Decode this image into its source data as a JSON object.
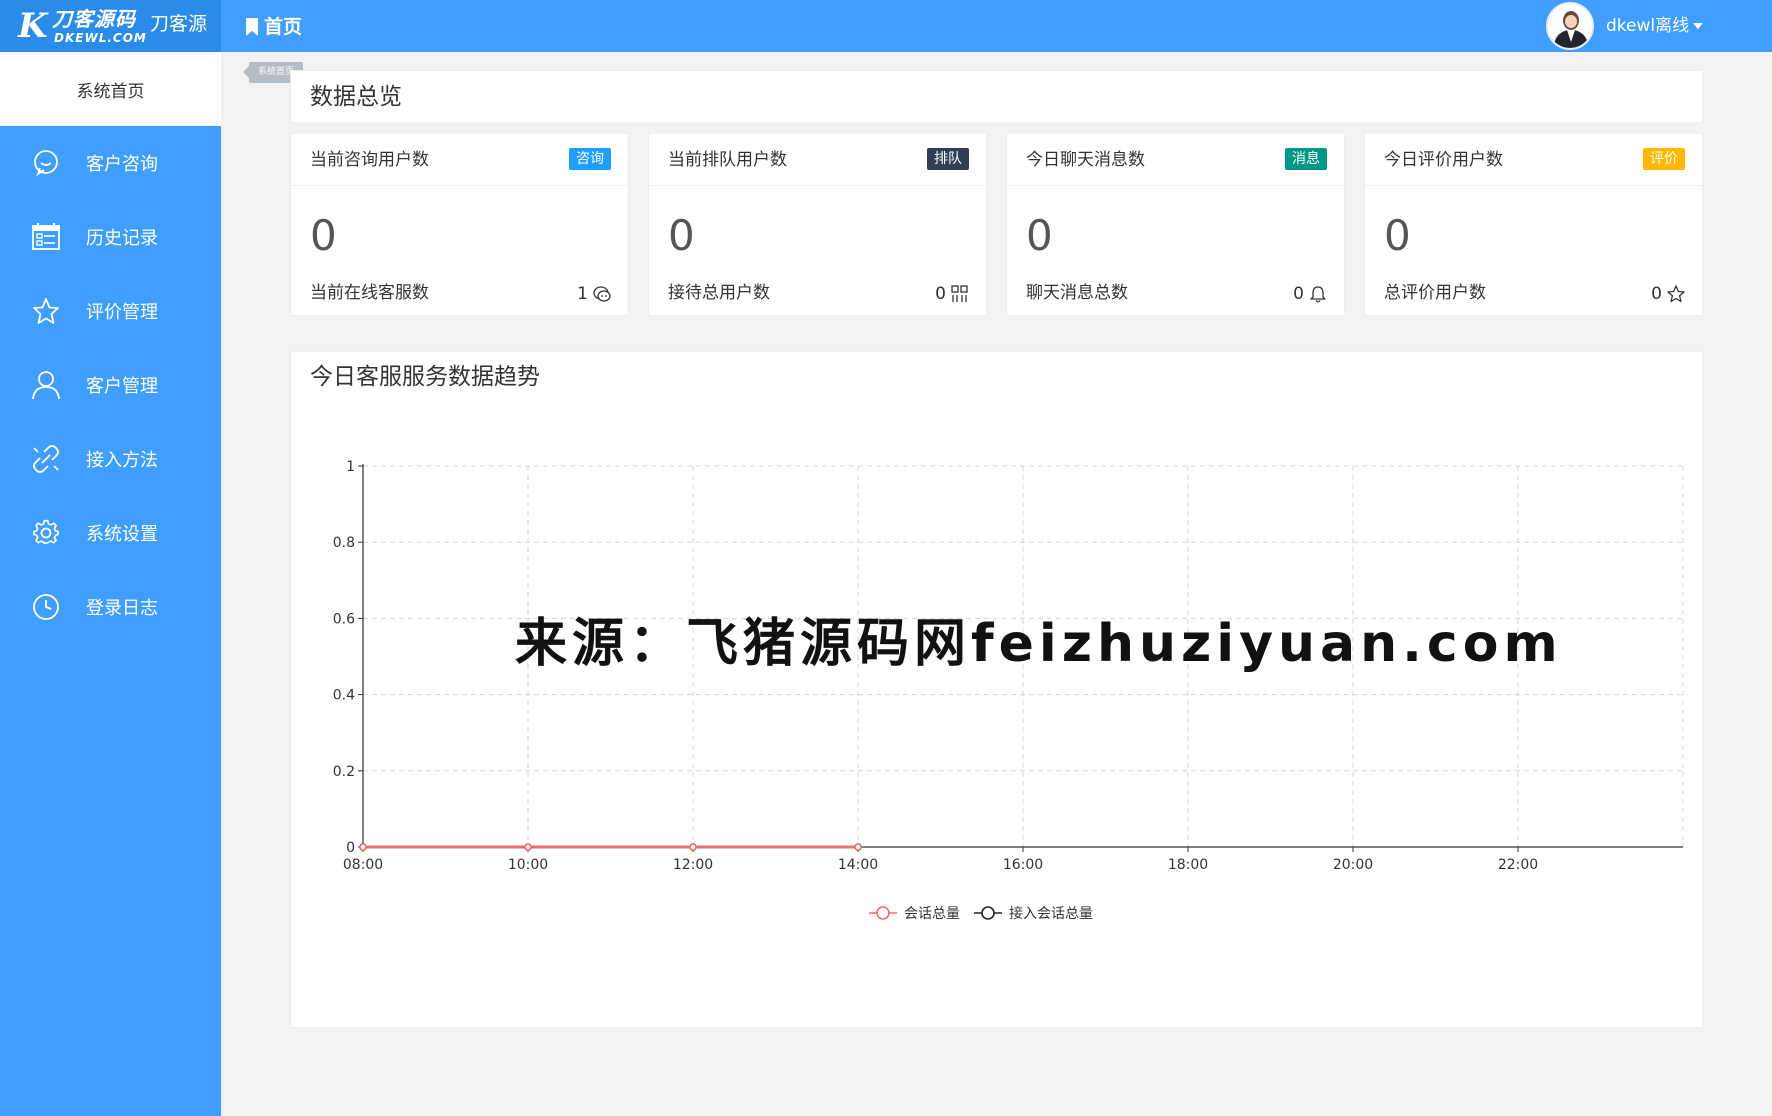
{
  "header": {
    "logo_text": "刀客源码",
    "logo_sub": "DKEWL.COM",
    "site_name": "刀客源",
    "breadcrumb": "首页",
    "user_status": "dkewl离线"
  },
  "sidebar": {
    "home_label": "系统首页",
    "items": [
      {
        "label": "客户咨询",
        "icon": "chat-bubble-icon"
      },
      {
        "label": "历史记录",
        "icon": "calendar-list-icon"
      },
      {
        "label": "评价管理",
        "icon": "star-icon"
      },
      {
        "label": "客户管理",
        "icon": "user-icon"
      },
      {
        "label": "接入方法",
        "icon": "link-icon"
      },
      {
        "label": "系统设置",
        "icon": "gear-icon"
      },
      {
        "label": "登录日志",
        "icon": "clock-icon"
      }
    ]
  },
  "tooltip": "系统首页",
  "overview": {
    "title": "数据总览"
  },
  "cards": [
    {
      "title": "当前咨询用户数",
      "badge": "咨询",
      "badge_color": "#1e9fff",
      "value": "0",
      "sub_label": "当前在线客服数",
      "sub_value": "1",
      "icon": "wechat-icon"
    },
    {
      "title": "当前排队用户数",
      "badge": "排队",
      "badge_color": "#2f4056",
      "value": "0",
      "sub_label": "接待总用户数",
      "sub_value": "0",
      "icon": "grid-icon"
    },
    {
      "title": "今日聊天消息数",
      "badge": "消息",
      "badge_color": "#009688",
      "value": "0",
      "sub_label": "聊天消息总数",
      "sub_value": "0",
      "icon": "bell-icon"
    },
    {
      "title": "今日评价用户数",
      "badge": "评价",
      "badge_color": "#ffb800",
      "value": "0",
      "sub_label": "总评价用户数",
      "sub_value": "0",
      "icon": "star-outline-icon"
    }
  ],
  "watermark": "来源：飞猪源码网feizhuziyuan.com",
  "chart_data": {
    "type": "line",
    "title": "今日客服服务数据趋势",
    "xlabel": "",
    "ylabel": "",
    "categories": [
      "08:00",
      "10:00",
      "12:00",
      "14:00",
      "16:00",
      "18:00",
      "20:00",
      "22:00"
    ],
    "ylim": [
      0,
      1
    ],
    "yticks": [
      "0",
      "0.2",
      "0.4",
      "0.6",
      "0.8",
      "1"
    ],
    "grid": true,
    "legend": "bottom-center",
    "series": [
      {
        "name": "会话总量",
        "color": "#f56c6c",
        "values": [
          0,
          0,
          0,
          0
        ]
      },
      {
        "name": "接入会话总量",
        "color": "#222222",
        "values": [
          0,
          0,
          0,
          0
        ]
      }
    ]
  }
}
